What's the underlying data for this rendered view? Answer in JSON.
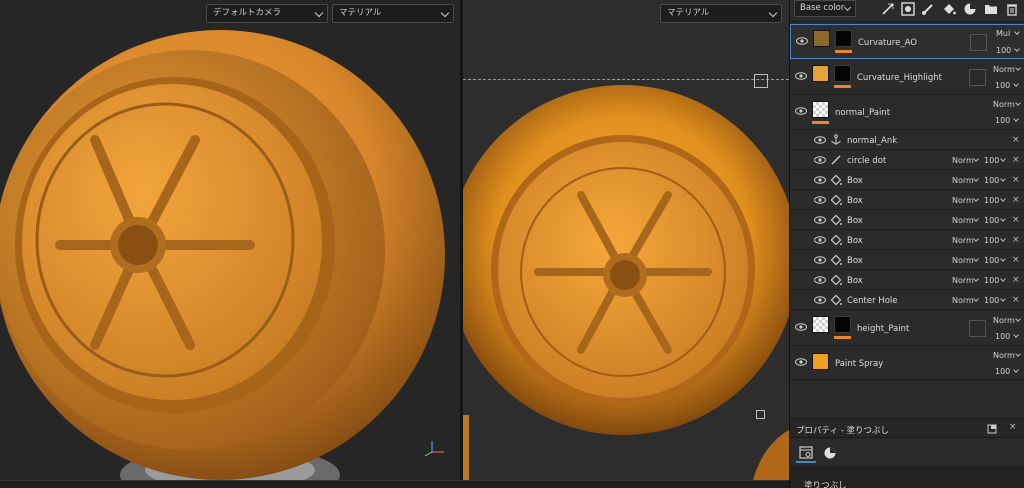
{
  "viewport_left": {
    "camera_select": "デフォルトカメラ",
    "material_select": "マテリアル"
  },
  "viewport_right": {
    "material_select": "マテリアル"
  },
  "toolbar": {
    "channel_select": "Base color",
    "icons": [
      "fx-effect-icon",
      "smart-mask-icon",
      "brush-icon",
      "fill-bucket-icon",
      "material-icon",
      "folder-icon",
      "trash-icon"
    ]
  },
  "layers": [
    {
      "name": "Curvature_AO",
      "blend": "Mul",
      "opacity": "100",
      "thumb_color": "#8a6a2a",
      "selected": true
    },
    {
      "name": "Curvature_Highlight",
      "blend": "Norm",
      "opacity": "100",
      "thumb_color": "#e0a438"
    },
    {
      "name": "normal_Paint",
      "blend": "Norm",
      "opacity": "100",
      "thumb": "checker"
    },
    {
      "name": "height_Paint",
      "blend": "Norm",
      "opacity": "100",
      "thumb": "checker"
    },
    {
      "name": "Paint Spray",
      "blend": "Norm",
      "opacity": "100",
      "thumb_color": "#f0a020"
    }
  ],
  "sub_effects": [
    {
      "name": "normal_Ank",
      "icon": "anchor-icon"
    },
    {
      "name": "circle dot",
      "icon": "brush-stroke-icon",
      "blend": "Norm",
      "opacity": "100"
    },
    {
      "name": "Box",
      "icon": "fill-icon",
      "blend": "Norm",
      "opacity": "100"
    },
    {
      "name": "Box",
      "icon": "fill-icon",
      "blend": "Norm",
      "opacity": "100"
    },
    {
      "name": "Box",
      "icon": "fill-icon",
      "blend": "Norm",
      "opacity": "100"
    },
    {
      "name": "Box",
      "icon": "fill-icon",
      "blend": "Norm",
      "opacity": "100"
    },
    {
      "name": "Box",
      "icon": "fill-icon",
      "blend": "Norm",
      "opacity": "100"
    },
    {
      "name": "Box",
      "icon": "fill-icon",
      "blend": "Norm",
      "opacity": "100"
    },
    {
      "name": "Center Hole",
      "icon": "fill-icon",
      "blend": "Norm",
      "opacity": "100"
    }
  ],
  "properties": {
    "title": "プロパティ - 塗りつぶし",
    "section_label": "塗りつぶし"
  },
  "colors": {
    "accent": "#e8862a",
    "selection": "#4b86c6",
    "panel_bg": "#2a2a2a"
  }
}
